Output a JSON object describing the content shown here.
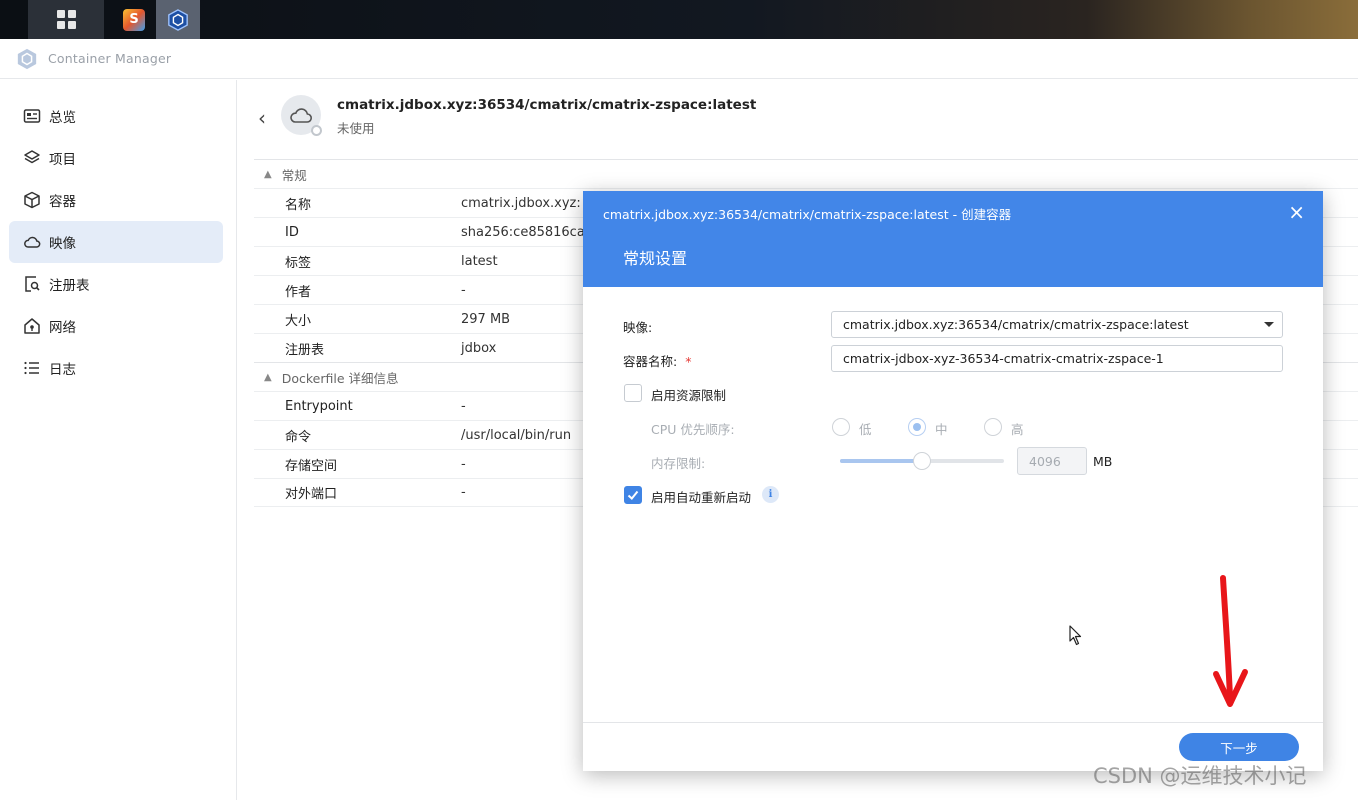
{
  "app": {
    "title": "Container Manager"
  },
  "sidebar": {
    "items": [
      {
        "label": "总览",
        "icon": "overview-icon"
      },
      {
        "label": "项目",
        "icon": "layers-icon"
      },
      {
        "label": "容器",
        "icon": "box-icon"
      },
      {
        "label": "映像",
        "icon": "cloud-icon",
        "active": true
      },
      {
        "label": "注册表",
        "icon": "registry-icon"
      },
      {
        "label": "网络",
        "icon": "network-icon"
      },
      {
        "label": "日志",
        "icon": "list-icon"
      }
    ]
  },
  "image": {
    "name": "cmatrix.jdbox.xyz:36534/cmatrix/cmatrix-zspace:latest",
    "status": "未使用"
  },
  "general": {
    "section": "常规",
    "rows": [
      {
        "k": "名称",
        "v": "cmatrix.jdbox.xyz:"
      },
      {
        "k": "ID",
        "v": "sha256:ce85816ca"
      },
      {
        "k": "标签",
        "v": "latest"
      },
      {
        "k": "作者",
        "v": "-"
      },
      {
        "k": "大小",
        "v": "297 MB"
      },
      {
        "k": "注册表",
        "v": "jdbox"
      }
    ]
  },
  "dockerfile": {
    "section": "Dockerfile 详细信息",
    "rows": [
      {
        "k": "Entrypoint",
        "v": "-"
      },
      {
        "k": "命令",
        "v": "/usr/local/bin/run"
      },
      {
        "k": "存储空间",
        "v": "-"
      },
      {
        "k": "对外端口",
        "v": "-"
      }
    ]
  },
  "modal": {
    "title": "cmatrix.jdbox.xyz:36534/cmatrix/cmatrix-zspace:latest - 创建容器",
    "subtitle": "常规设置",
    "close": "×",
    "image_label": "映像:",
    "image_value": "cmatrix.jdbox.xyz:36534/cmatrix/cmatrix-zspace:latest",
    "name_label": "容器名称:",
    "required_mark": "*",
    "name_value": "cmatrix-jdbox-xyz-36534-cmatrix-cmatrix-zspace-1",
    "resource_limit_label": "启用资源限制",
    "resource_limit_checked": false,
    "cpu_label": "CPU 优先顺序:",
    "cpu_options": [
      "低",
      "中",
      "高"
    ],
    "cpu_selected": "中",
    "mem_label": "内存限制:",
    "mem_value": "4096",
    "mem_unit": "MB",
    "mem_slider_level": 0.5,
    "auto_restart_label": "启用自动重新启动",
    "auto_restart_checked": true,
    "info_glyph": "i",
    "next_label": "下一步"
  },
  "watermark": "CSDN @运维技术小记",
  "colors": {
    "primary": "#4286e8",
    "button": "#3f84e5",
    "annotation_arrow": "#e8161a"
  }
}
